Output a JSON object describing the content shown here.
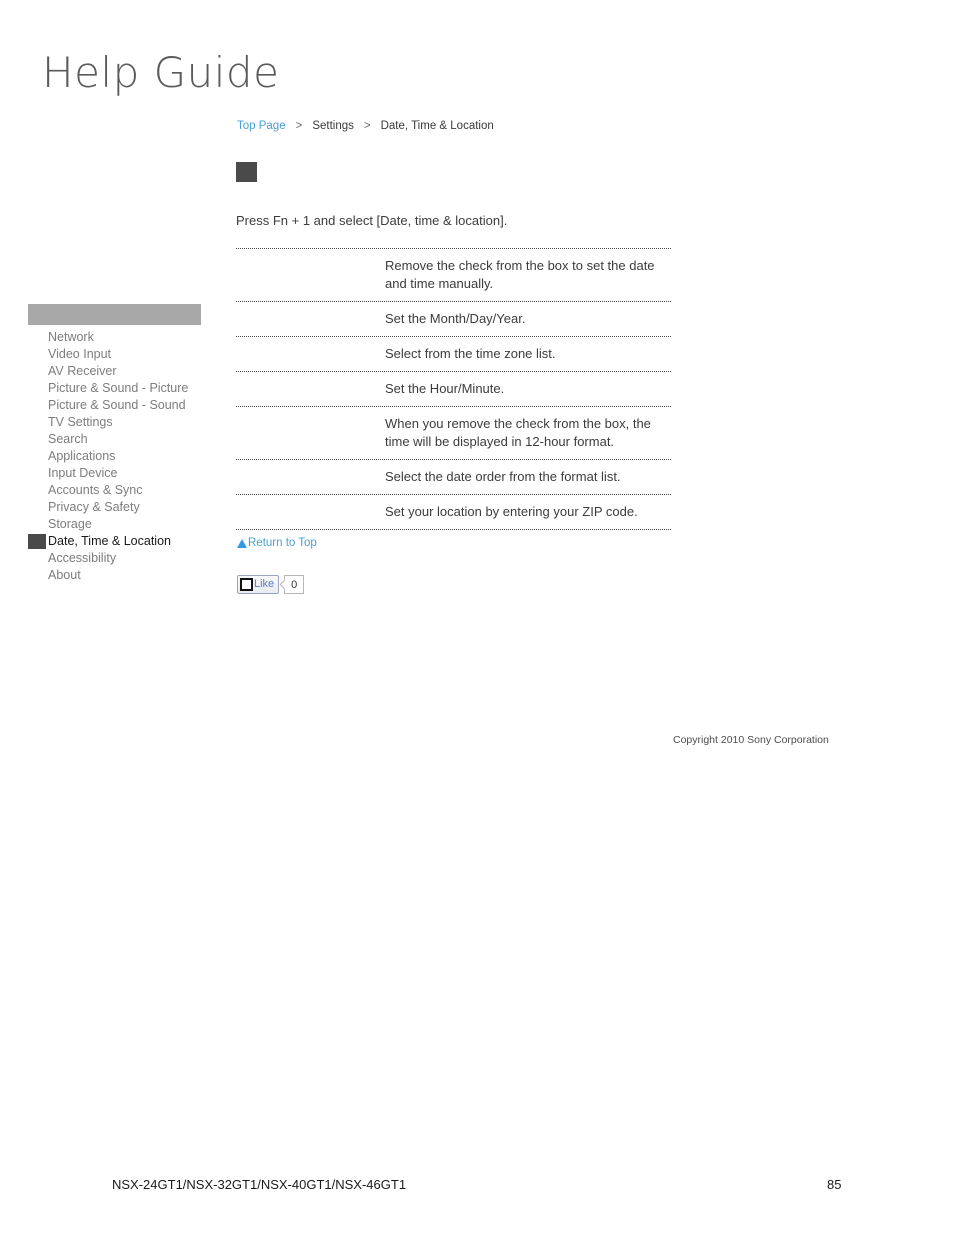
{
  "logo": {
    "text": "Help Guide"
  },
  "breadcrumb": {
    "top_page": "Top Page",
    "separator1": ">",
    "settings": "Settings",
    "separator2": ">",
    "current": "Date, Time & Location"
  },
  "sidebar": {
    "header_label": "",
    "items": [
      {
        "label": "Network",
        "active": false
      },
      {
        "label": "Video Input",
        "active": false
      },
      {
        "label": "AV Receiver",
        "active": false
      },
      {
        "label": "Picture & Sound - Picture",
        "active": false
      },
      {
        "label": "Picture & Sound - Sound",
        "active": false
      },
      {
        "label": "TV Settings",
        "active": false
      },
      {
        "label": "Search",
        "active": false
      },
      {
        "label": "Applications",
        "active": false
      },
      {
        "label": "Input Device",
        "active": false
      },
      {
        "label": "Accounts & Sync",
        "active": false
      },
      {
        "label": "Privacy & Safety",
        "active": false
      },
      {
        "label": "Storage",
        "active": false
      },
      {
        "label": "Date, Time & Location",
        "active": true
      },
      {
        "label": "Accessibility",
        "active": false
      },
      {
        "label": "About",
        "active": false
      }
    ]
  },
  "content": {
    "heading": "",
    "intro": "Press Fn + 1 and select [Date, time & location].",
    "table": {
      "rows": [
        {
          "label": "",
          "description": "Remove the check from the box to set the date and time manually."
        },
        {
          "label": "",
          "description": "Set the Month/Day/Year."
        },
        {
          "label": "",
          "description": "Select from the time zone list."
        },
        {
          "label": "",
          "description": "Set the Hour/Minute."
        },
        {
          "label": "",
          "description": "When you remove the check from the box, the time will be displayed in 12-hour format."
        },
        {
          "label": "",
          "description": "Select the date order from the format list."
        },
        {
          "label": "",
          "description": "Set your location by entering your ZIP code."
        }
      ]
    }
  },
  "return_to_top": {
    "label": "Return to Top"
  },
  "like_widget": {
    "label": "Like",
    "count": "0"
  },
  "copyright": {
    "text": "Copyright 2010 Sony Corporation"
  },
  "footer": {
    "model": "NSX-24GT1/NSX-32GT1/NSX-40GT1/NSX-46GT1",
    "page_number": "85"
  },
  "colors": {
    "link_blue": "#4a9fd4",
    "sidebar_header_gray": "#a8a8a8",
    "marker_dark": "#4a4a4a",
    "text_gray": "#7d7d7d",
    "like_blue": "#5b7bbd"
  }
}
